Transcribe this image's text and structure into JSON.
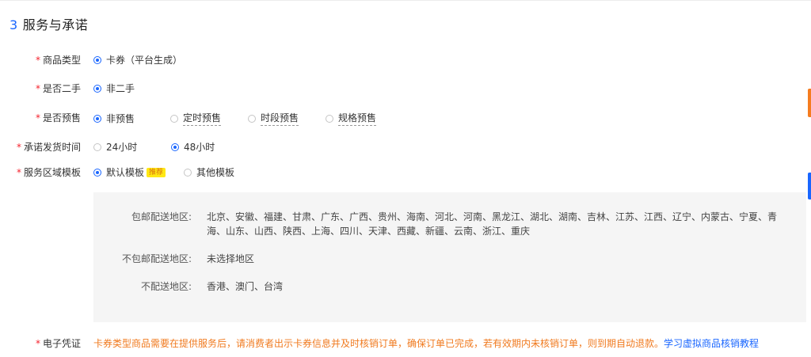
{
  "section": {
    "number": "3",
    "title": "服务与承诺"
  },
  "rows": [
    {
      "label": "商品类型",
      "required": "*",
      "options": [
        {
          "text": "卡券（平台生成）",
          "selected": true
        }
      ]
    },
    {
      "label": "是否二手",
      "required": "*",
      "options": [
        {
          "text": "非二手",
          "selected": true
        }
      ]
    },
    {
      "label": "是否预售",
      "required": "*",
      "options": [
        {
          "text": "非预售",
          "selected": true
        },
        {
          "text": "定时预售",
          "selected": false
        },
        {
          "text": "时段预售",
          "selected": false
        },
        {
          "text": "规格预售",
          "selected": false
        }
      ]
    },
    {
      "label": "承诺发货时间",
      "required": "*",
      "options": [
        {
          "text": "24小时",
          "selected": false
        },
        {
          "text": "48小时",
          "selected": true
        }
      ]
    },
    {
      "label": "服务区域模板",
      "required": "*",
      "options": [
        {
          "text": "默认模板",
          "selected": true,
          "badge": "推荐"
        },
        {
          "text": "其他模板",
          "selected": false
        }
      ]
    }
  ],
  "shipping": {
    "free_label": "包邮配送地区:",
    "free_line1": "北京、安徽、福建、甘肃、广东、广西、贵州、海南、河北、河南、黑龙江、湖北、湖南、吉林、江苏、江西、辽宁、内蒙古、宁夏、青",
    "free_line2": "海、山东、山西、陕西、上海、四川、天津、西藏、新疆、云南、浙江、重庆",
    "not_free_label": "不包邮配送地区:",
    "not_free_value": "未选择地区",
    "no_ship_label": "不配送地区:",
    "no_ship_value": "香港、澳门、台湾"
  },
  "voucher": {
    "label": "电子凭证",
    "required": "*",
    "text": "卡券类型商品需要在提供服务后，请消费者出示卡券信息并及时核销订单，确保订单已完成，若有效期内未核销订单，则到期自动退款。",
    "link": "学习虚拟商品核销教程"
  },
  "colors": {
    "accent": "#1966ff",
    "required": "#f5222d",
    "warning": "#f07a1f",
    "badge_bg": "#ffe815"
  }
}
